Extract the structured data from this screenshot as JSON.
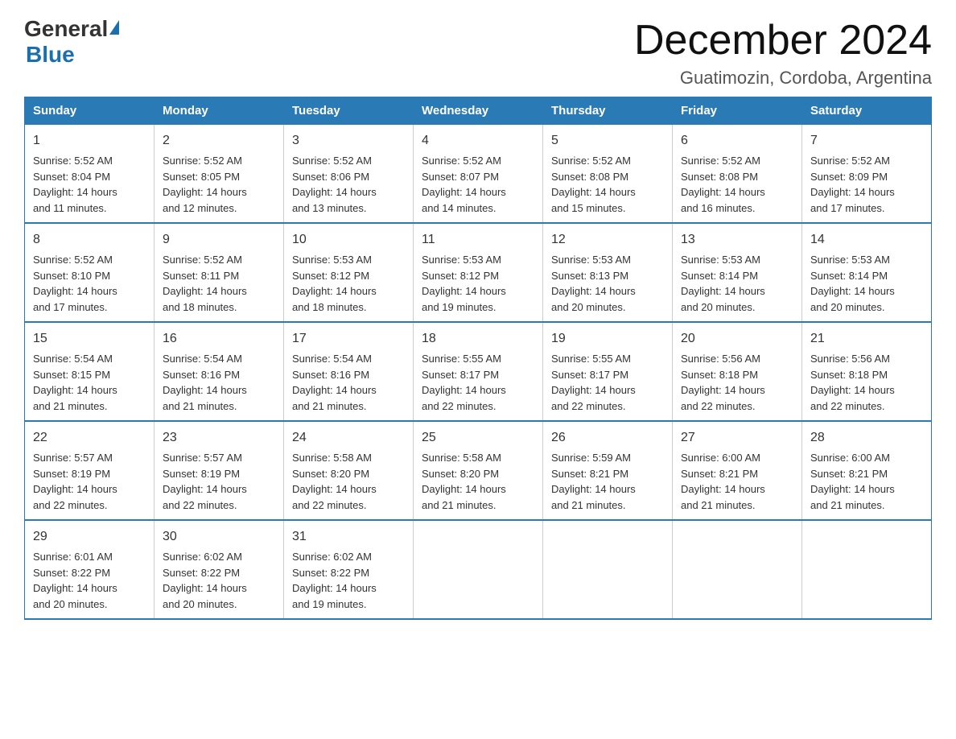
{
  "header": {
    "logo_general": "General",
    "logo_blue": "Blue",
    "month_title": "December 2024",
    "location": "Guatimozin, Cordoba, Argentina"
  },
  "days_of_week": [
    "Sunday",
    "Monday",
    "Tuesday",
    "Wednesday",
    "Thursday",
    "Friday",
    "Saturday"
  ],
  "weeks": [
    [
      {
        "day": "1",
        "sunrise": "5:52 AM",
        "sunset": "8:04 PM",
        "daylight": "14 hours and 11 minutes."
      },
      {
        "day": "2",
        "sunrise": "5:52 AM",
        "sunset": "8:05 PM",
        "daylight": "14 hours and 12 minutes."
      },
      {
        "day": "3",
        "sunrise": "5:52 AM",
        "sunset": "8:06 PM",
        "daylight": "14 hours and 13 minutes."
      },
      {
        "day": "4",
        "sunrise": "5:52 AM",
        "sunset": "8:07 PM",
        "daylight": "14 hours and 14 minutes."
      },
      {
        "day": "5",
        "sunrise": "5:52 AM",
        "sunset": "8:08 PM",
        "daylight": "14 hours and 15 minutes."
      },
      {
        "day": "6",
        "sunrise": "5:52 AM",
        "sunset": "8:08 PM",
        "daylight": "14 hours and 16 minutes."
      },
      {
        "day": "7",
        "sunrise": "5:52 AM",
        "sunset": "8:09 PM",
        "daylight": "14 hours and 17 minutes."
      }
    ],
    [
      {
        "day": "8",
        "sunrise": "5:52 AM",
        "sunset": "8:10 PM",
        "daylight": "14 hours and 17 minutes."
      },
      {
        "day": "9",
        "sunrise": "5:52 AM",
        "sunset": "8:11 PM",
        "daylight": "14 hours and 18 minutes."
      },
      {
        "day": "10",
        "sunrise": "5:53 AM",
        "sunset": "8:12 PM",
        "daylight": "14 hours and 18 minutes."
      },
      {
        "day": "11",
        "sunrise": "5:53 AM",
        "sunset": "8:12 PM",
        "daylight": "14 hours and 19 minutes."
      },
      {
        "day": "12",
        "sunrise": "5:53 AM",
        "sunset": "8:13 PM",
        "daylight": "14 hours and 20 minutes."
      },
      {
        "day": "13",
        "sunrise": "5:53 AM",
        "sunset": "8:14 PM",
        "daylight": "14 hours and 20 minutes."
      },
      {
        "day": "14",
        "sunrise": "5:53 AM",
        "sunset": "8:14 PM",
        "daylight": "14 hours and 20 minutes."
      }
    ],
    [
      {
        "day": "15",
        "sunrise": "5:54 AM",
        "sunset": "8:15 PM",
        "daylight": "14 hours and 21 minutes."
      },
      {
        "day": "16",
        "sunrise": "5:54 AM",
        "sunset": "8:16 PM",
        "daylight": "14 hours and 21 minutes."
      },
      {
        "day": "17",
        "sunrise": "5:54 AM",
        "sunset": "8:16 PM",
        "daylight": "14 hours and 21 minutes."
      },
      {
        "day": "18",
        "sunrise": "5:55 AM",
        "sunset": "8:17 PM",
        "daylight": "14 hours and 22 minutes."
      },
      {
        "day": "19",
        "sunrise": "5:55 AM",
        "sunset": "8:17 PM",
        "daylight": "14 hours and 22 minutes."
      },
      {
        "day": "20",
        "sunrise": "5:56 AM",
        "sunset": "8:18 PM",
        "daylight": "14 hours and 22 minutes."
      },
      {
        "day": "21",
        "sunrise": "5:56 AM",
        "sunset": "8:18 PM",
        "daylight": "14 hours and 22 minutes."
      }
    ],
    [
      {
        "day": "22",
        "sunrise": "5:57 AM",
        "sunset": "8:19 PM",
        "daylight": "14 hours and 22 minutes."
      },
      {
        "day": "23",
        "sunrise": "5:57 AM",
        "sunset": "8:19 PM",
        "daylight": "14 hours and 22 minutes."
      },
      {
        "day": "24",
        "sunrise": "5:58 AM",
        "sunset": "8:20 PM",
        "daylight": "14 hours and 22 minutes."
      },
      {
        "day": "25",
        "sunrise": "5:58 AM",
        "sunset": "8:20 PM",
        "daylight": "14 hours and 21 minutes."
      },
      {
        "day": "26",
        "sunrise": "5:59 AM",
        "sunset": "8:21 PM",
        "daylight": "14 hours and 21 minutes."
      },
      {
        "day": "27",
        "sunrise": "6:00 AM",
        "sunset": "8:21 PM",
        "daylight": "14 hours and 21 minutes."
      },
      {
        "day": "28",
        "sunrise": "6:00 AM",
        "sunset": "8:21 PM",
        "daylight": "14 hours and 21 minutes."
      }
    ],
    [
      {
        "day": "29",
        "sunrise": "6:01 AM",
        "sunset": "8:22 PM",
        "daylight": "14 hours and 20 minutes."
      },
      {
        "day": "30",
        "sunrise": "6:02 AM",
        "sunset": "8:22 PM",
        "daylight": "14 hours and 20 minutes."
      },
      {
        "day": "31",
        "sunrise": "6:02 AM",
        "sunset": "8:22 PM",
        "daylight": "14 hours and 19 minutes."
      },
      null,
      null,
      null,
      null
    ]
  ],
  "labels": {
    "sunrise": "Sunrise:",
    "sunset": "Sunset:",
    "daylight": "Daylight:"
  }
}
